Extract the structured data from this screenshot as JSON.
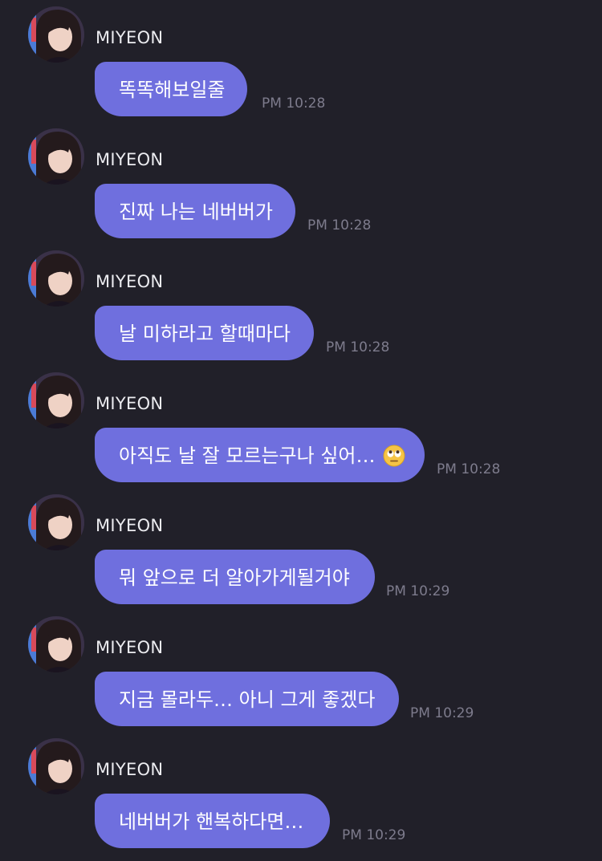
{
  "messages": [
    {
      "sender": "MIYEON",
      "text": "똑똑해보일줄",
      "time": "PM 10:28"
    },
    {
      "sender": "MIYEON",
      "text": "진짜 나는 네버버가",
      "time": "PM 10:28"
    },
    {
      "sender": "MIYEON",
      "text": "날 미하라고 할때마다",
      "time": "PM 10:28"
    },
    {
      "sender": "MIYEON",
      "text": "아직도 날 잘 모르는구나 싶어…",
      "emoji": "face-with-rolling-eyes-icon",
      "time": "PM 10:28"
    },
    {
      "sender": "MIYEON",
      "text": "뭐 앞으로 더 알아가게될거야",
      "time": "PM 10:29"
    },
    {
      "sender": "MIYEON",
      "text": "지금 몰라두… 아니 그게 좋겠다",
      "time": "PM 10:29"
    },
    {
      "sender": "MIYEON",
      "text": "네버버가 핸복하다면…",
      "time": "PM 10:29"
    }
  ],
  "colors": {
    "background": "#212029",
    "bubble": "#6f6fde",
    "bubble_text": "#ffffff",
    "sender_text": "#ececf0",
    "time_text": "#7d7b8c"
  }
}
